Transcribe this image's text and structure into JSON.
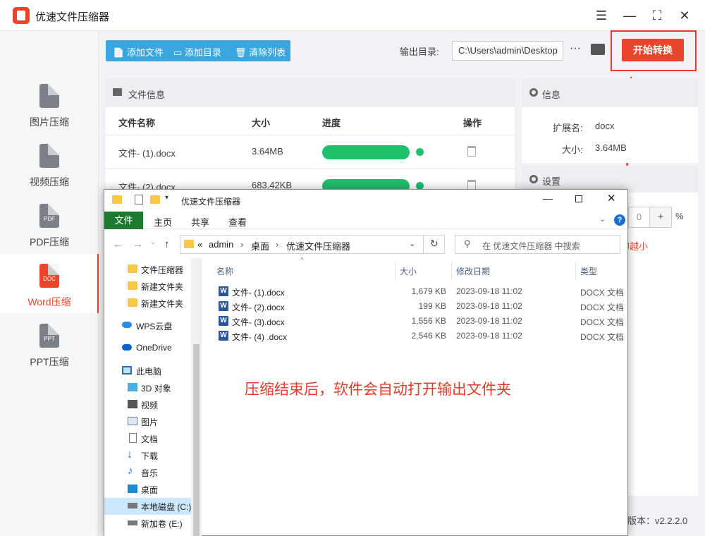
{
  "app": {
    "title": "优速文件压缩器",
    "window_controls": [
      "☰",
      "—",
      "⛶",
      "✕"
    ]
  },
  "sidebar": {
    "items": [
      {
        "label": "图片压缩",
        "icon": "image-file-icon",
        "badge": ""
      },
      {
        "label": "视频压缩",
        "icon": "video-file-icon",
        "badge": ""
      },
      {
        "label": "PDF压缩",
        "icon": "pdf-file-icon",
        "badge": "PDF"
      },
      {
        "label": "Word压缩",
        "icon": "doc-file-icon",
        "badge": "DOC"
      },
      {
        "label": "PPT压缩",
        "icon": "ppt-file-icon",
        "badge": "PPT"
      }
    ],
    "active_index": 3
  },
  "toolbar": {
    "add_file": "添加文件",
    "add_dir": "添加目录",
    "clear_list": "清除列表",
    "output_label": "输出目录:",
    "output_path": "C:\\Users\\admin\\Desktop",
    "more": "···",
    "start": "开始转换"
  },
  "file_panel": {
    "title": "文件信息",
    "columns": [
      "文件名称",
      "大小",
      "进度",
      "操作"
    ],
    "rows": [
      {
        "name": "文件- (1).docx",
        "size": "3.64MB",
        "progress": 1.0
      },
      {
        "name": "文件- (2).docx",
        "size": "683.42KB",
        "progress": 1.0
      }
    ]
  },
  "info_panel": {
    "title": "信息",
    "ext_label": "扩展名:",
    "ext_value": "docx",
    "size_label": "大小:",
    "size_value": "3.64MB"
  },
  "settings_panel": {
    "title": "设置",
    "value": "0",
    "plus": "+",
    "unit": "%",
    "hint": "却越小"
  },
  "version": "版本：v2.2.2.0",
  "explorer": {
    "title": "优速文件压缩器",
    "ribbon": {
      "file": "文件",
      "tabs": [
        "主页",
        "共享",
        "查看"
      ]
    },
    "address": [
      "«",
      "admin",
      "›",
      "桌面",
      "›",
      "优速文件压缩器"
    ],
    "search_placeholder": "在 优速文件压缩器 中搜索",
    "nav": [
      {
        "label": "文件压缩器",
        "icon": "folder-icon"
      },
      {
        "label": "新建文件夹",
        "icon": "folder-icon"
      },
      {
        "label": "新建文件夹",
        "icon": "folder-icon"
      },
      {
        "label": "WPS云盘",
        "icon": "cloud-icon"
      },
      {
        "label": "OneDrive",
        "icon": "onedrive-icon"
      },
      {
        "label": "此电脑",
        "icon": "pc-icon"
      },
      {
        "label": "3D 对象",
        "icon": "3d-objects-icon"
      },
      {
        "label": "视频",
        "icon": "video-icon"
      },
      {
        "label": "图片",
        "icon": "pictures-icon"
      },
      {
        "label": "文档",
        "icon": "documents-icon"
      },
      {
        "label": "下载",
        "icon": "download-icon"
      },
      {
        "label": "音乐",
        "icon": "music-icon"
      },
      {
        "label": "桌面",
        "icon": "desktop-icon"
      },
      {
        "label": "本地磁盘 (C:)",
        "icon": "drive-icon"
      },
      {
        "label": "新加卷 (E:)",
        "icon": "drive-icon"
      }
    ],
    "columns": [
      "名称",
      "大小",
      "修改日期",
      "类型"
    ],
    "files": [
      {
        "name": "文件- (1).docx",
        "size": "1,679 KB",
        "date": "2023-09-18 11:02",
        "type": "DOCX 文档"
      },
      {
        "name": "文件- (2).docx",
        "size": "199 KB",
        "date": "2023-09-18 11:02",
        "type": "DOCX 文档"
      },
      {
        "name": "文件- (3).docx",
        "size": "1,556 KB",
        "date": "2023-09-18 11:02",
        "type": "DOCX 文档"
      },
      {
        "name": "文件- (4) .docx",
        "size": "2,546 KB",
        "date": "2023-09-18 11:02",
        "type": "DOCX 文档"
      }
    ]
  },
  "annotation": "压缩结束后，软件会自动打开输出文件夹",
  "colors": {
    "accent": "#e8452c",
    "toolbar_blue": "#3aa6e0",
    "progress_green": "#1fbf6b",
    "explorer_file_tab": "#1e7a2e"
  }
}
